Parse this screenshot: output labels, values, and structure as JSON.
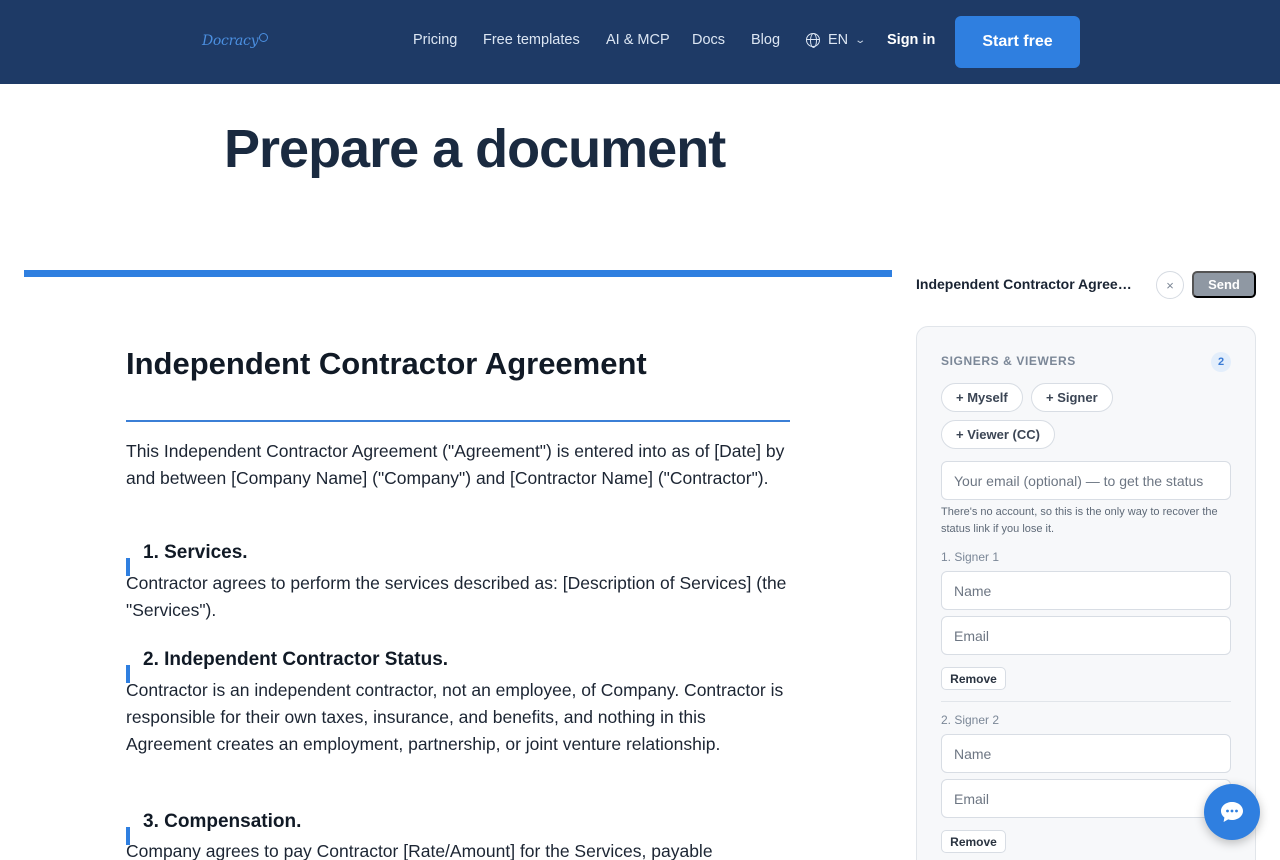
{
  "header": {
    "logo_text": "Docracy",
    "nav": [
      {
        "label": "Pricing"
      },
      {
        "label": "Free templates"
      },
      {
        "label": "AI & MCP"
      },
      {
        "label": "Docs"
      },
      {
        "label": "Blog"
      }
    ],
    "language": "EN",
    "sign_in": "Sign in",
    "start_free": "Start free"
  },
  "page": {
    "title": "Prepare a document"
  },
  "document": {
    "title": "Independent Contractor Agreement",
    "intro": "This Independent Contractor Agreement (\"Agreement\") is entered into as of [Date] by and between [Company Name] (\"Company\") and [Contractor Name] (\"Contractor\").",
    "sections": [
      {
        "heading": "1. Services.",
        "body": "Contractor agrees to perform the services described as: [Description of Services] (the \"Services\")."
      },
      {
        "heading": "2. Independent Contractor Status.",
        "body": "Contractor is an independent contractor, not an employee, of Company. Contractor is responsible for their own taxes, insurance, and benefits, and nothing in this Agreement creates an employment, partnership, or joint venture relationship."
      },
      {
        "heading": "3. Compensation.",
        "body": "Company agrees to pay Contractor [Rate/Amount] for the Services, payable"
      }
    ]
  },
  "panel": {
    "doc_name": "Independent Contractor Agreeme...",
    "close_symbol": "×",
    "send_label": "Send",
    "section_label": "SIGNERS & VIEWERS",
    "count": "2",
    "chips": {
      "myself": "+ Myself",
      "signer": "+ Signer",
      "viewer": "+ Viewer (CC)"
    },
    "owner_email_placeholder": "Your email (optional) — to get the status",
    "hint": "There's no account, so this is the only way to recover the status link if you lose it.",
    "signers": [
      {
        "label": "1. Signer 1",
        "name_placeholder": "Name",
        "email_placeholder": "Email",
        "remove_label": "Remove"
      },
      {
        "label": "2. Signer 2",
        "name_placeholder": "Name",
        "email_placeholder": "Email",
        "remove_label": "Remove"
      }
    ]
  },
  "colors": {
    "header_bg": "#1e3a66",
    "accent": "#2f7fe0",
    "send_disabled": "#8f98a3"
  },
  "icons": {
    "language": "globe-icon",
    "language_toggle": "chevron-down-icon",
    "close": "close-icon",
    "chat": "chat-bubble-icon"
  }
}
